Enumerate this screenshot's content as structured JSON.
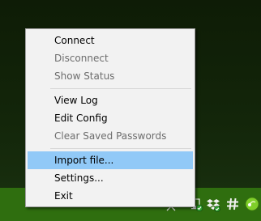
{
  "menu": {
    "items": [
      {
        "label": "Connect",
        "enabled": true
      },
      {
        "label": "Disconnect",
        "enabled": false
      },
      {
        "label": "Show Status",
        "enabled": false
      },
      {
        "label": "View Log",
        "enabled": true
      },
      {
        "label": "Edit Config",
        "enabled": true
      },
      {
        "label": "Clear Saved Passwords",
        "enabled": false
      },
      {
        "label": "Import file...",
        "enabled": true,
        "highlighted": true
      },
      {
        "label": "Settings...",
        "enabled": true
      },
      {
        "label": "Exit",
        "enabled": true
      }
    ]
  },
  "tray": {
    "icons": [
      "chevron-up-icon",
      "network-icon",
      "dropbox-icon",
      "hashtag-icon",
      "openvpn-icon"
    ]
  },
  "colors": {
    "taskbar": "#2f6e0f",
    "menu_bg": "#f2f2f2",
    "highlight": "#91c9f7",
    "disabled_text": "#6d6d6d"
  }
}
